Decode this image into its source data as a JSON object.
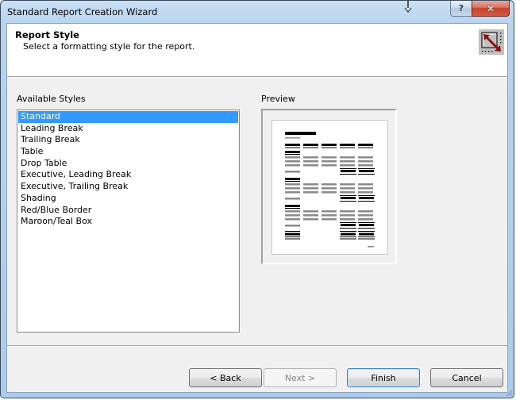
{
  "window": {
    "title": "Standard Report Creation Wizard",
    "help_icon": "help-icon",
    "help_glyph": "?",
    "close_icon": "close-icon",
    "close_glyph": "✕"
  },
  "header": {
    "title": "Report Style",
    "subtitle": "Select a formatting style for the report.",
    "icon": "report-wizard-icon"
  },
  "styles": {
    "label": "Available Styles",
    "selected_index": 0,
    "items": [
      "Standard",
      "Leading Break",
      "Trailing Break",
      "Table",
      "Drop Table",
      "Executive, Leading Break",
      "Executive, Trailing Break",
      "Shading",
      "Red/Blue Border",
      "Maroon/Teal Box"
    ]
  },
  "preview": {
    "label": "Preview",
    "colors": {
      "dark": "#000000",
      "gray": "#8a8a8a"
    }
  },
  "buttons": {
    "back": "< Back",
    "next": "Next >",
    "finish": "Finish",
    "cancel": "Cancel"
  },
  "colors": {
    "selection": "#3399ff",
    "dialog_bg": "#f0f0f0",
    "close_red": "#c8412c",
    "icon_arrow": "#8b1010"
  }
}
